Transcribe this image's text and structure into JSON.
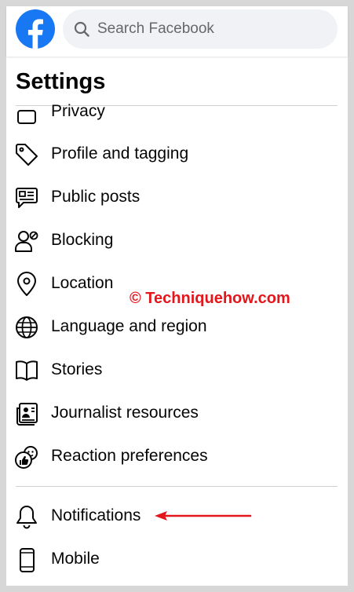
{
  "header": {
    "logo_icon": "facebook-logo-icon",
    "search": {
      "placeholder": "Search Facebook",
      "value": "",
      "icon": "search-icon"
    }
  },
  "page": {
    "title": "Settings"
  },
  "menu": {
    "items": [
      {
        "label": "Privacy",
        "icon": "lock-icon"
      },
      {
        "label": "Profile and tagging",
        "icon": "tag-icon"
      },
      {
        "label": "Public posts",
        "icon": "public-posts-icon"
      },
      {
        "label": "Blocking",
        "icon": "blocking-icon"
      },
      {
        "label": "Location",
        "icon": "location-pin-icon"
      },
      {
        "label": "Language and region",
        "icon": "globe-icon"
      },
      {
        "label": "Stories",
        "icon": "book-icon"
      },
      {
        "label": "Journalist resources",
        "icon": "journalist-card-icon"
      },
      {
        "label": "Reaction preferences",
        "icon": "reaction-icon"
      },
      {
        "label": "Notifications",
        "icon": "bell-icon"
      },
      {
        "label": "Mobile",
        "icon": "mobile-phone-icon"
      }
    ]
  },
  "watermark": {
    "text": "© Techniquehow.com"
  },
  "annotation": {
    "arrow_color": "#e3161b",
    "points_to": "Notifications"
  },
  "colors": {
    "brand": "#1877f2",
    "text": "#050505",
    "search_bg": "#f0f2f5",
    "divider": "#ced0d4",
    "watermark": "#e3161b"
  }
}
